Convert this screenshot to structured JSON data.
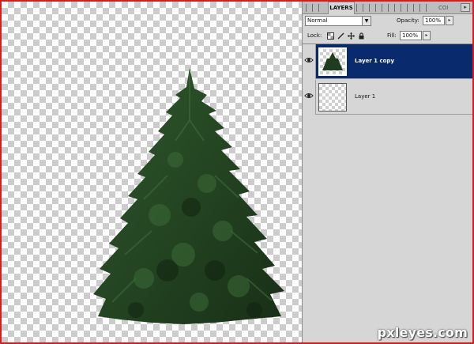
{
  "panel": {
    "tab_title": "LAYERS",
    "tab_short": "COI",
    "tab_menu_icon": "menu-arrow-icon"
  },
  "blend": {
    "mode": "Normal"
  },
  "opacity": {
    "label": "Opacity:",
    "value": "100%"
  },
  "lock": {
    "label": "Lock:"
  },
  "fill": {
    "label": "Fill:",
    "value": "100%"
  },
  "layers": [
    {
      "name": "Layer 1 copy",
      "selected": true,
      "visible": true
    },
    {
      "name": "Layer 1",
      "selected": false,
      "visible": true
    }
  ],
  "watermark": "pxleyes.com",
  "colors": {
    "frame": "#d61d1d",
    "selected_layer": "#0a2a6e",
    "panel_bg": "#d6d6d6",
    "tree_dark": "#1d3a1c",
    "tree_mid": "#2f5a2c"
  }
}
